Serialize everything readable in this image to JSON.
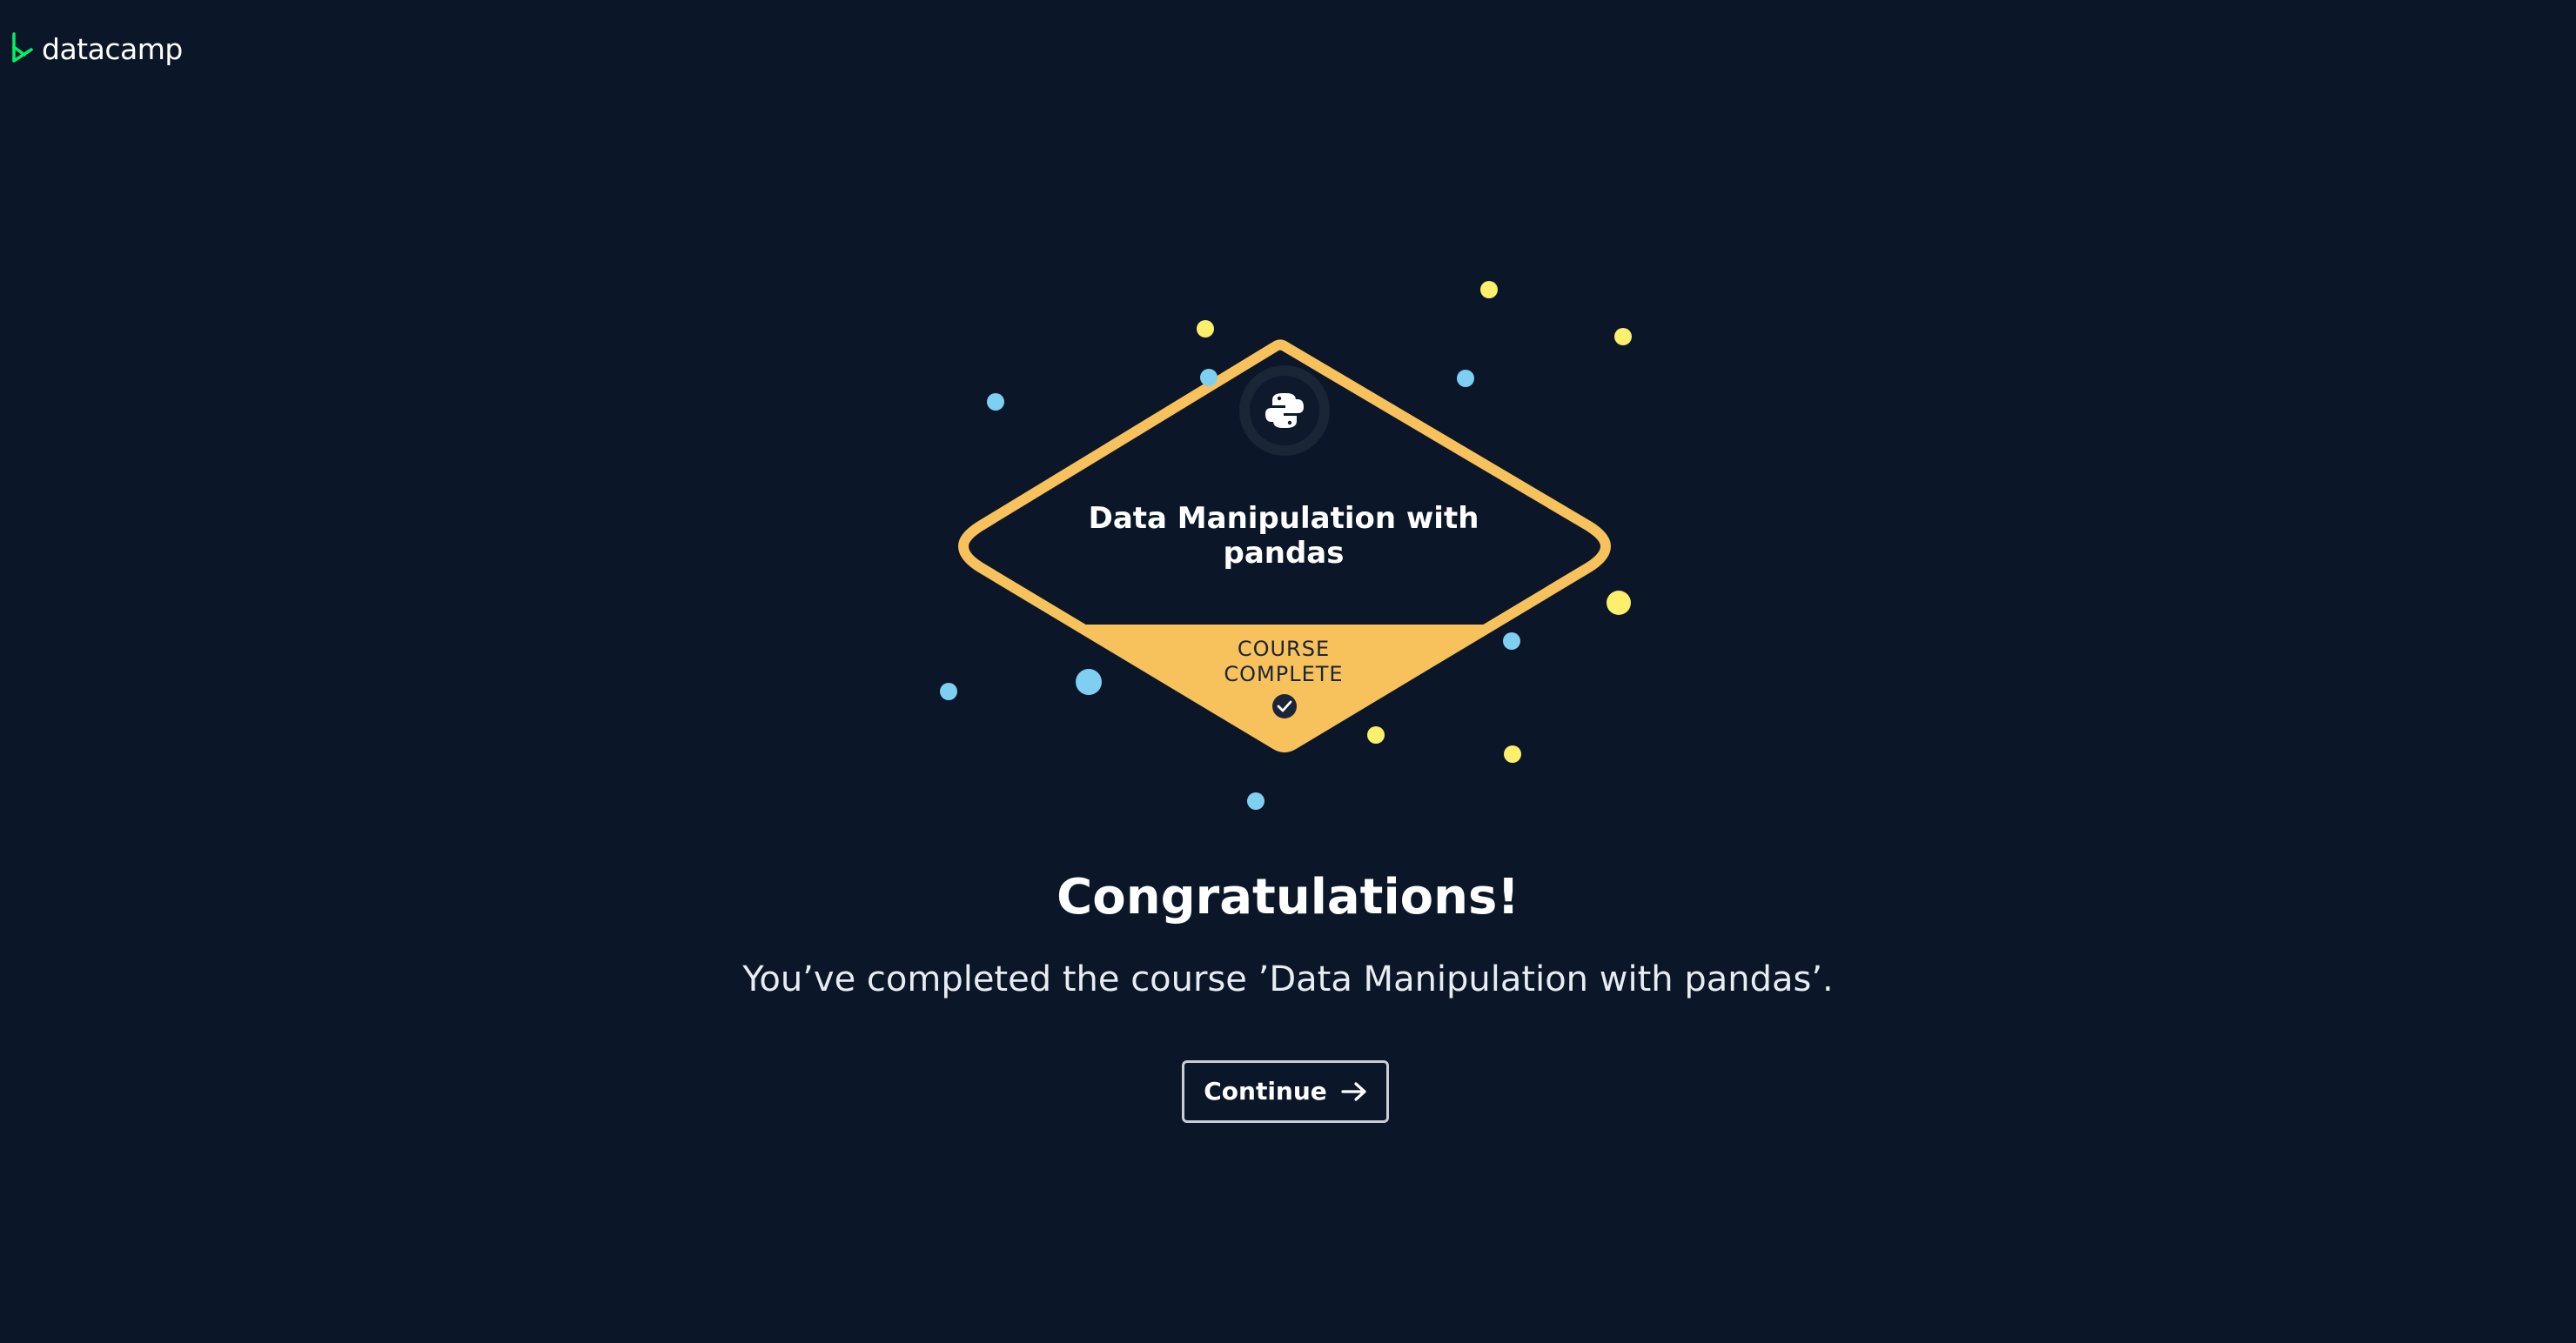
{
  "app": {
    "logo_text": "datacamp",
    "logo_icon": "datacamp-logo-icon",
    "accent_green": "#03ef62"
  },
  "badge": {
    "title": "Data Manipulation with pandas",
    "status_label": "COURSE COMPLETE",
    "technology_icon": "python-icon",
    "status_icon": "checkmark-icon",
    "frame_color": "#f7c15c",
    "background_color": "#0b1729"
  },
  "message": {
    "headline": "Congratulations!",
    "body": "You’ve completed the course ’Data Manipulation with pandas’."
  },
  "actions": {
    "continue_label": "Continue",
    "continue_icon": "arrow-right-icon"
  },
  "confetti_colors": {
    "yellow": "#fbef6b",
    "blue": "#7ecff2"
  }
}
